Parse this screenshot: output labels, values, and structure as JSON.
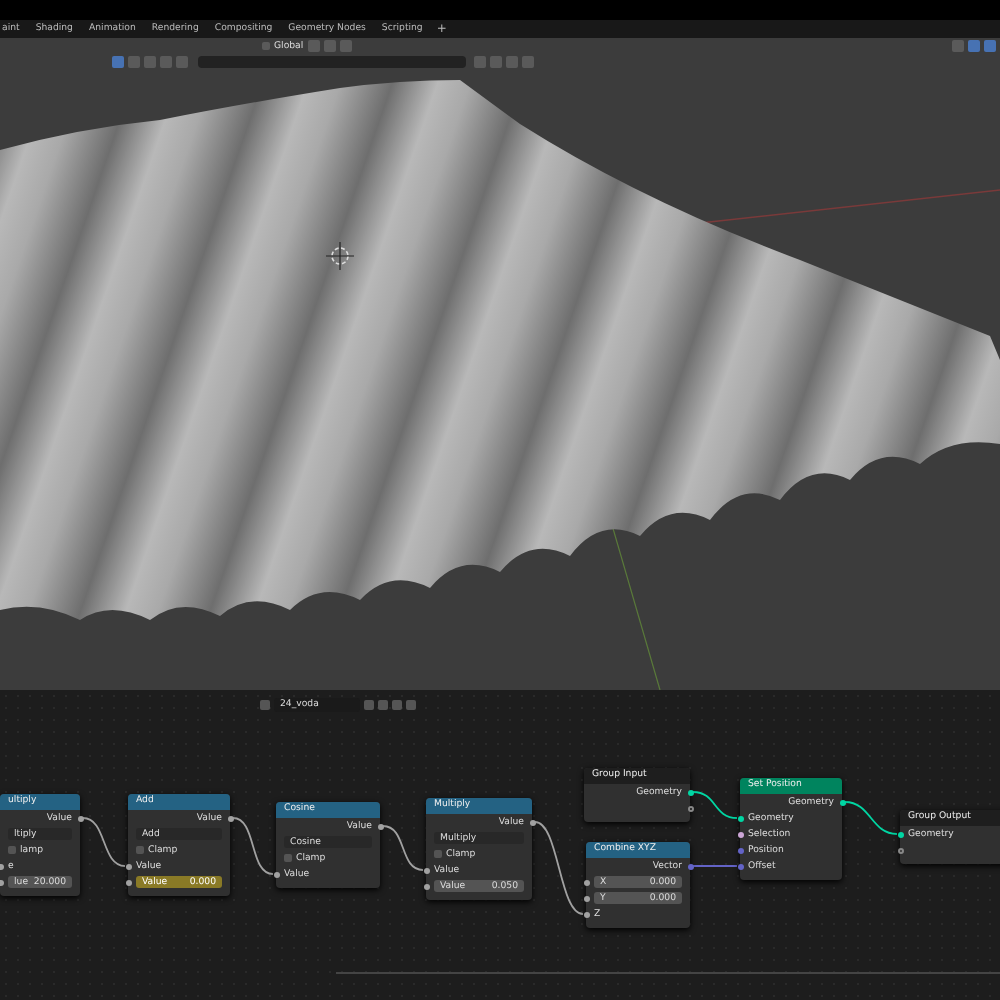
{
  "workspace_tabs": [
    {
      "label": "aint",
      "selected": false
    },
    {
      "label": "Shading",
      "selected": false
    },
    {
      "label": "Animation",
      "selected": false
    },
    {
      "label": "Rendering",
      "selected": false
    },
    {
      "label": "Compositing",
      "selected": false
    },
    {
      "label": "Geometry Nodes",
      "selected": false
    },
    {
      "label": "Scripting",
      "selected": false
    }
  ],
  "add_workspace": "+",
  "viewport_header": {
    "orientation": "Global"
  },
  "node_editor": {
    "node_tree": "24_voda",
    "nodes": [
      {
        "title": "ultiply",
        "kind": "math",
        "rows": [
          {
            "kind": "output",
            "label": "Value",
            "color": "#a1a1a1"
          },
          {
            "kind": "dropdown",
            "value": "ltiply"
          },
          {
            "kind": "checkbox",
            "label": "lamp",
            "checked": false
          },
          {
            "kind": "input",
            "label": "e",
            "color": "#a1a1a1"
          },
          {
            "kind": "field",
            "label": "lue",
            "value": "20.000",
            "color": "#a1a1a1",
            "highlighted": false
          }
        ]
      },
      {
        "title": "Add",
        "kind": "math",
        "rows": [
          {
            "kind": "output",
            "label": "Value",
            "color": "#a1a1a1"
          },
          {
            "kind": "dropdown",
            "value": "Add"
          },
          {
            "kind": "checkbox",
            "label": "Clamp",
            "checked": false
          },
          {
            "kind": "input",
            "label": "Value",
            "color": "#a1a1a1"
          },
          {
            "kind": "field",
            "label": "Value",
            "value": "0.000",
            "color": "#a1a1a1",
            "highlighted": true
          }
        ]
      },
      {
        "title": "Cosine",
        "kind": "math",
        "rows": [
          {
            "kind": "output",
            "label": "Value",
            "color": "#a1a1a1"
          },
          {
            "kind": "dropdown",
            "value": "Cosine"
          },
          {
            "kind": "checkbox",
            "label": "Clamp",
            "checked": false
          },
          {
            "kind": "input",
            "label": "Value",
            "color": "#a1a1a1"
          }
        ]
      },
      {
        "title": "Multiply",
        "kind": "math",
        "rows": [
          {
            "kind": "output",
            "label": "Value",
            "color": "#a1a1a1"
          },
          {
            "kind": "dropdown",
            "value": "Multiply"
          },
          {
            "kind": "checkbox",
            "label": "Clamp",
            "checked": false
          },
          {
            "kind": "input",
            "label": "Value",
            "color": "#a1a1a1"
          },
          {
            "kind": "field",
            "label": "Value",
            "value": "0.050",
            "color": "#a1a1a1",
            "highlighted": false
          }
        ]
      },
      {
        "title": "Group Input",
        "kind": "group",
        "rows": [
          {
            "kind": "output",
            "label": "Geometry",
            "color": "#00d6a3"
          },
          {
            "kind": "output"
          }
        ]
      },
      {
        "title": "Combine XYZ",
        "kind": "math",
        "rows": [
          {
            "kind": "output",
            "label": "Vector",
            "color": "#6363c7"
          },
          {
            "kind": "field",
            "label": "X",
            "value": "0.000",
            "color": "#a1a1a1",
            "highlighted": false
          },
          {
            "kind": "field",
            "label": "Y",
            "value": "0.000",
            "color": "#a1a1a1",
            "highlighted": false
          },
          {
            "kind": "input",
            "label": "Z",
            "color": "#a1a1a1"
          }
        ]
      },
      {
        "title": "Set Position",
        "kind": "geometry",
        "rows": [
          {
            "kind": "output",
            "label": "Geometry",
            "color": "#00d6a3"
          },
          {
            "kind": "input",
            "label": "Geometry",
            "color": "#00d6a3"
          },
          {
            "kind": "input",
            "label": "Selection",
            "color": "#cca6d6"
          },
          {
            "kind": "input",
            "label": "Position",
            "color": "#6363c7"
          },
          {
            "kind": "input",
            "label": "Offset",
            "color": "#6363c7"
          }
        ]
      },
      {
        "title": "Group Output",
        "kind": "group",
        "rows": [
          {
            "kind": "input",
            "label": "Geometry",
            "color": "#00d6a3"
          },
          {
            "kind": "input"
          }
        ]
      }
    ]
  }
}
